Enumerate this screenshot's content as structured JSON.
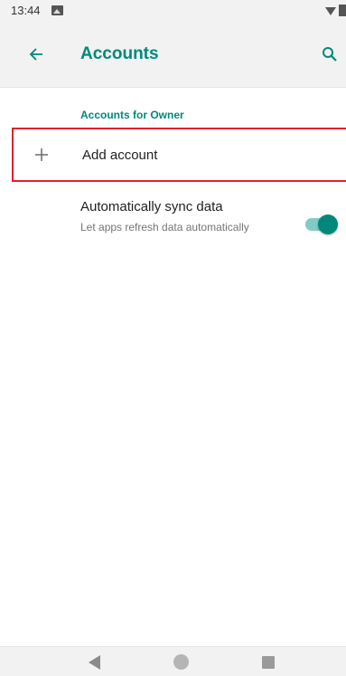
{
  "status_bar": {
    "time": "13:44",
    "icons": [
      "image-icon",
      "wifi-icon",
      "battery-icon"
    ]
  },
  "app_bar": {
    "title": "Accounts",
    "back_icon": "arrow-left-icon",
    "search_icon": "search-icon"
  },
  "section": {
    "header": "Accounts for Owner"
  },
  "add_account": {
    "label": "Add account",
    "icon": "plus-icon"
  },
  "sync": {
    "title": "Automatically sync data",
    "summary": "Let apps refresh data automatically",
    "enabled": true
  },
  "nav_bar": {
    "icons": [
      "back-icon",
      "home-icon",
      "recents-icon"
    ]
  },
  "colors": {
    "accent": "#00897b",
    "accent_light": "#80cbc4",
    "highlight_border": "#e3202c",
    "bar_background": "#f2f2f2"
  }
}
